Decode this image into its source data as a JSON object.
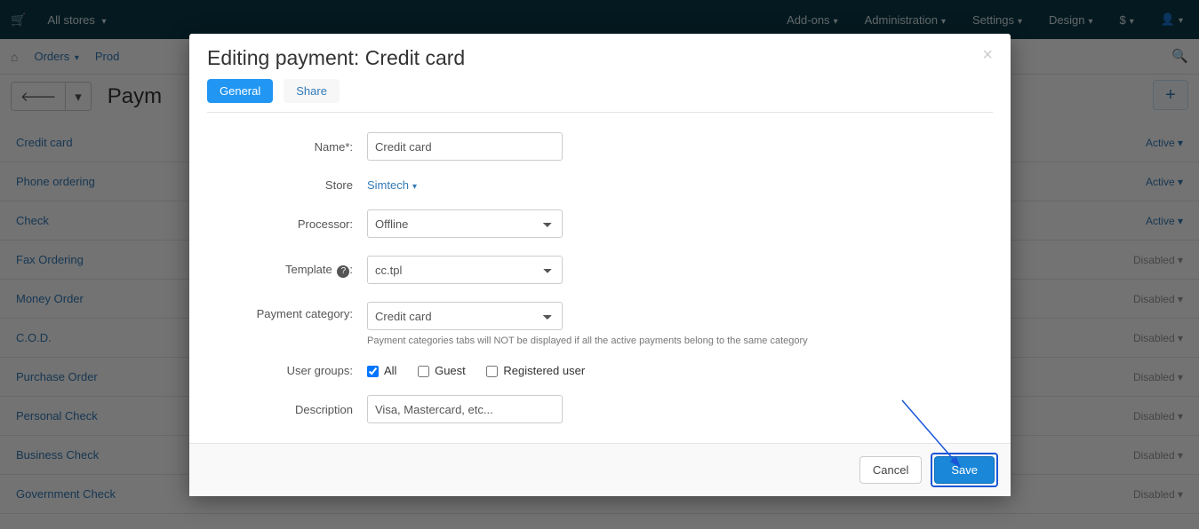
{
  "topbar": {
    "all_stores": "All stores",
    "menu": [
      "Add-ons",
      "Administration",
      "Settings",
      "Design"
    ],
    "currency": "$"
  },
  "subbar": {
    "links": [
      "Orders",
      "Prod"
    ]
  },
  "page": {
    "title": "Paym"
  },
  "payments": [
    {
      "name": "Credit card",
      "status": "Active",
      "status_type": "active"
    },
    {
      "name": "Phone ordering",
      "status": "Active",
      "status_type": "active"
    },
    {
      "name": "Check",
      "status": "Active",
      "status_type": "active"
    },
    {
      "name": "Fax Ordering",
      "status": "Disabled",
      "status_type": "disabled"
    },
    {
      "name": "Money Order",
      "status": "Disabled",
      "status_type": "disabled"
    },
    {
      "name": "C.O.D.",
      "status": "Disabled",
      "status_type": "disabled"
    },
    {
      "name": "Purchase Order",
      "status": "Disabled",
      "status_type": "disabled"
    },
    {
      "name": "Personal Check",
      "status": "Disabled",
      "status_type": "disabled"
    },
    {
      "name": "Business Check",
      "status": "Disabled",
      "status_type": "disabled"
    },
    {
      "name": "Government Check",
      "status": "Disabled",
      "status_type": "disabled"
    }
  ],
  "modal": {
    "title": "Editing payment: Credit card",
    "tabs": {
      "general": "General",
      "share": "Share"
    },
    "labels": {
      "name": "Name",
      "store": "Store",
      "processor": "Processor:",
      "template": "Template",
      "payment_category": "Payment category:",
      "user_groups": "User groups:",
      "description": "Description"
    },
    "values": {
      "name": "Credit card",
      "store": "Simtech",
      "processor": "Offline",
      "template": "cc.tpl",
      "payment_category": "Credit card",
      "description": "Visa, Mastercard, etc..."
    },
    "payment_category_hint": "Payment categories tabs will NOT be displayed if all the active payments belong to the same category",
    "user_groups": {
      "all": "All",
      "guest": "Guest",
      "registered": "Registered user"
    },
    "buttons": {
      "cancel": "Cancel",
      "save": "Save"
    }
  }
}
